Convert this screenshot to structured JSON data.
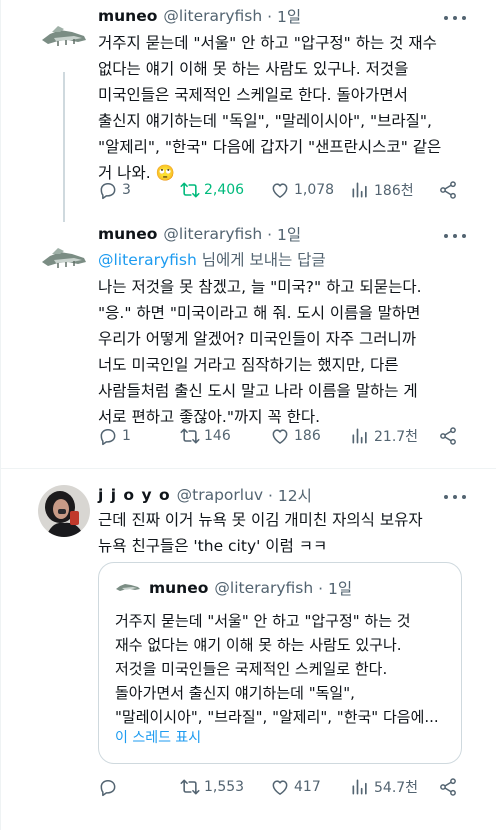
{
  "tweets": [
    {
      "name": "muneo",
      "handle": "@literaryfish",
      "time": "· 1일",
      "text": "거주지 묻는데 \"서울\" 안 하고 \"압구정\" 하는 것 재수\n없다는 얘기 이해 못 하는 사람도 있구나. 저것을\n미국인들은 국제적인 스케일로 한다. 돌아가면서\n출신지 얘기하는데 \"독일\", \"말레이시아\", \"브라질\",\n\"알제리\", \"한국\" 다음에 갑자기 \"샌프란시스코\" 같은\n거 나와. 🙄",
      "replies": "3",
      "retweets": "2,406",
      "likes": "1,078",
      "views": "186천"
    },
    {
      "name": "muneo",
      "handle": "@literaryfish",
      "time": "· 1일",
      "replying_mention": "@literaryfish",
      "replying_suffix": " 님에게 보내는 답글",
      "text": "나는 저것을 못 참겠고, 늘 \"미국?\" 하고 되묻는다.\n\"응.\" 하면 \"미국이라고 해 줘. 도시 이름을 말하면\n우리가 어떻게 알겠어? 미국인들이 자주 그러니까\n너도 미국인일 거라고 짐작하기는 했지만, 다른\n사람들처럼 출신 도시 말고 나라 이름을 말하는 게\n서로 편하고 좋잖아.\"까지 꼭 한다.",
      "replies": "1",
      "retweets": "146",
      "likes": "186",
      "views": "21.7천"
    },
    {
      "name": "j j o y o",
      "handle": "@traporluv",
      "time": "· 12시",
      "text": "근데 진짜 이거 뉴욕 못 이김 개미친 자의식 보유자\n뉴욕 친구들은 'the city' 이럼 ㅋㅋ",
      "replies": "",
      "retweets": "1,553",
      "likes": "417",
      "views": "54.7천",
      "quote": {
        "name": "muneo",
        "handle": "@literaryfish",
        "time": "· 1일",
        "text": "거주지 묻는데 \"서울\" 안 하고 \"압구정\" 하는 것\n재수 없다는 얘기 이해 못 하는 사람도 있구나.\n저것을 미국인들은 국제적인 스케일로 한다.\n돌아가면서 출신지 얘기하는데 \"독일\",\n\"말레이시아\", \"브라질\", \"알제리\", \"한국\" 다음에...",
        "show_thread": "이 스레드 표시"
      }
    }
  ],
  "colors": {
    "text": "#0f1419",
    "secondary": "#536471",
    "link": "#1d9bf0",
    "retweet_active": "#00ba7c",
    "border": "#cfd9de"
  }
}
